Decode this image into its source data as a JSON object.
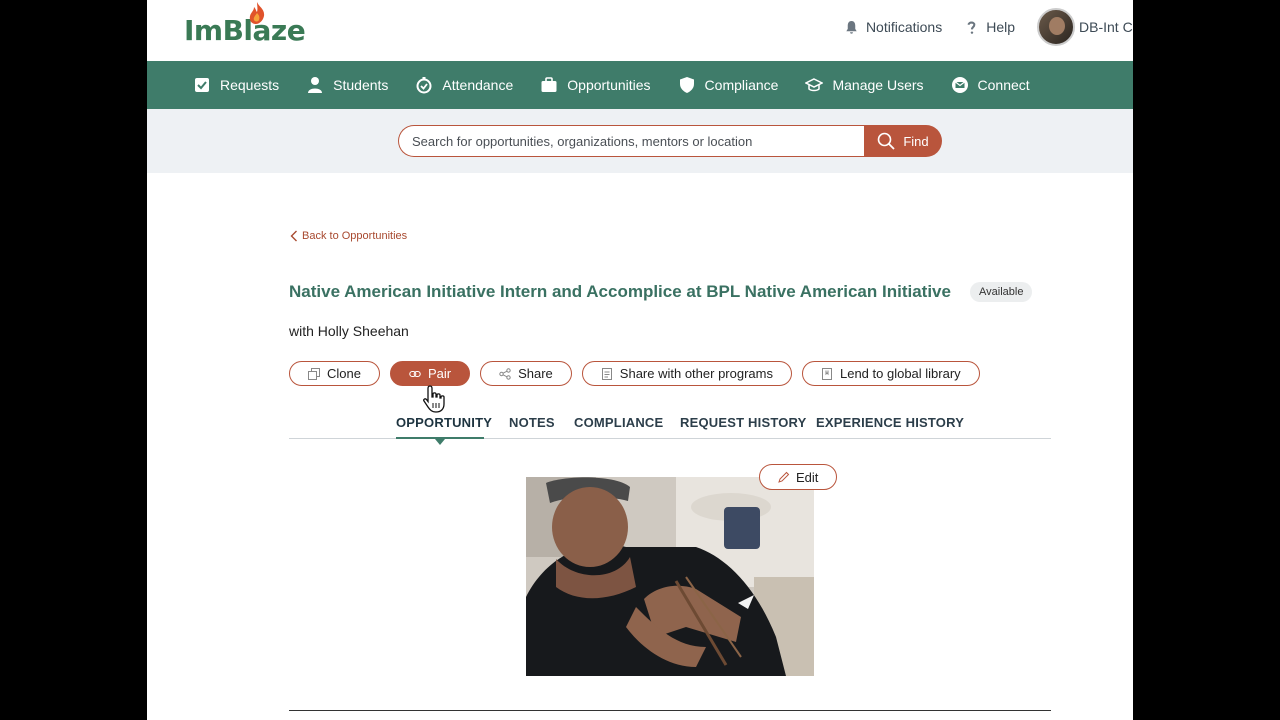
{
  "brand": {
    "logo_text": "ImBlaze",
    "primary": "#3f7c6a",
    "accent": "#b9553c"
  },
  "header": {
    "notifications_label": "Notifications",
    "help_label": "Help",
    "user_name": "DB-Int Co"
  },
  "nav": {
    "items": [
      {
        "label": "Requests",
        "icon": "checkbox-icon"
      },
      {
        "label": "Students",
        "icon": "person-icon"
      },
      {
        "label": "Attendance",
        "icon": "stopwatch-icon"
      },
      {
        "label": "Opportunities",
        "icon": "briefcase-icon"
      },
      {
        "label": "Compliance",
        "icon": "shield-icon"
      },
      {
        "label": "Manage Users",
        "icon": "graduation-cap-icon"
      },
      {
        "label": "Connect",
        "icon": "envelope-icon"
      }
    ]
  },
  "search": {
    "placeholder": "Search for opportunities, organizations, mentors or location",
    "button_label": "Find"
  },
  "content": {
    "back_label": "Back to Opportunities",
    "title": "Native American Initiative Intern and Accomplice at BPL Native American Initiative",
    "status_badge": "Available",
    "subtitle": "with Holly Sheehan",
    "actions": {
      "clone": "Clone",
      "pair": "Pair",
      "share": "Share",
      "share_programs": "Share with other programs",
      "lend": "Lend to global library"
    },
    "tabs": {
      "opportunity": "OPPORTUNITY",
      "notes": "NOTES",
      "compliance": "COMPLIANCE",
      "request_history": "REQUEST HISTORY",
      "experience_history": "EXPERIENCE HISTORY",
      "active": "opportunity"
    },
    "edit_label": "Edit"
  }
}
